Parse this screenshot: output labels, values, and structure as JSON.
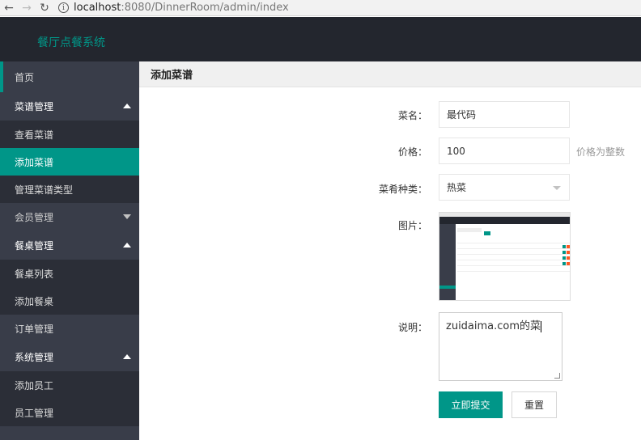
{
  "browser": {
    "url_host": "localhost",
    "url_path": ":8080/DinnerRoom/admin/index"
  },
  "app": {
    "title": "餐厅点餐系统"
  },
  "sidebar": {
    "items": [
      {
        "label": "首页"
      },
      {
        "label": "菜谱管理"
      },
      {
        "label": "查看菜谱"
      },
      {
        "label": "添加菜谱"
      },
      {
        "label": "管理菜谱类型"
      },
      {
        "label": "会员管理"
      },
      {
        "label": "餐桌管理"
      },
      {
        "label": "餐桌列表"
      },
      {
        "label": "添加餐桌"
      },
      {
        "label": "订单管理"
      },
      {
        "label": "系统管理"
      },
      {
        "label": "添加员工"
      },
      {
        "label": "员工管理"
      }
    ]
  },
  "main": {
    "title": "添加菜谱",
    "form": {
      "name_label": "菜名：",
      "name_value": "最代码",
      "price_label": "价格：",
      "price_value": "100",
      "price_hint": "价格为整数",
      "type_label": "菜肴种类：",
      "type_value": "热菜",
      "image_label": "图片：",
      "desc_label": "说明：",
      "desc_value": "zuidaima.com的菜",
      "submit_label": "立即提交",
      "reset_label": "重置"
    }
  },
  "colors": {
    "accent": "#009688",
    "header_bg": "#23262e",
    "sidebar_bg": "#393d49",
    "sidebar_sub_bg": "#2b2e37"
  },
  "icons": {
    "back": "back-arrow-icon",
    "forward": "forward-arrow-icon",
    "reload": "reload-icon",
    "info": "info-icon",
    "caret_up": "caret-up-icon",
    "caret_down": "caret-down-icon",
    "select_arrow": "chevron-down-icon"
  }
}
